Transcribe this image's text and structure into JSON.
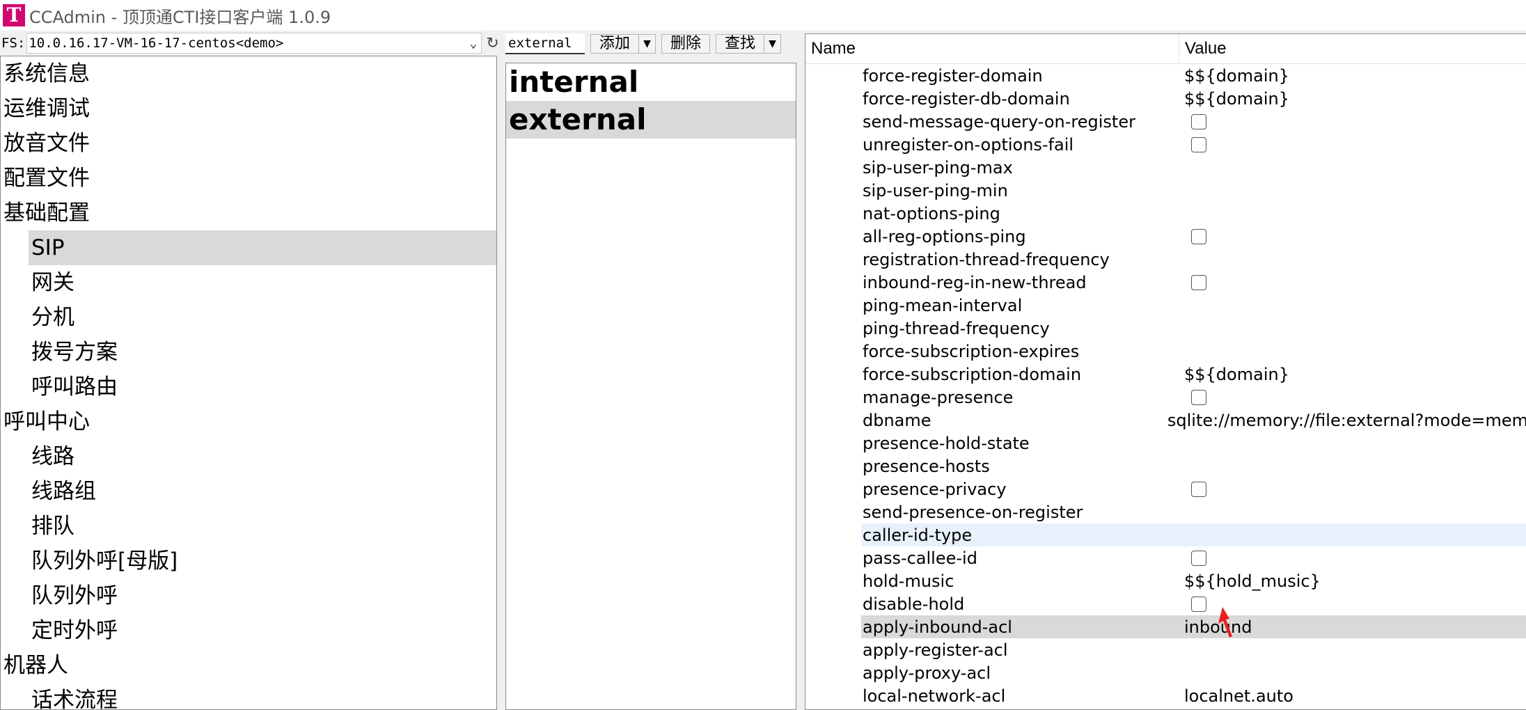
{
  "app": {
    "logo_letter": "T",
    "title": "CCAdmin - 顶顶通CTI接口客户端 1.0.9",
    "accent_color": "#d0076f"
  },
  "fs": {
    "label": "FS:",
    "server": "10.0.16.17-VM-16-17-centos<demo>"
  },
  "tree": {
    "items": [
      {
        "label": "系统信息",
        "level": 0
      },
      {
        "label": "运维调试",
        "level": 0
      },
      {
        "label": "放音文件",
        "level": 0
      },
      {
        "label": "配置文件",
        "level": 0
      },
      {
        "label": "基础配置",
        "level": 0
      },
      {
        "label": "SIP",
        "level": 1,
        "selected": true
      },
      {
        "label": "网关",
        "level": 1
      },
      {
        "label": "分机",
        "level": 1
      },
      {
        "label": "拨号方案",
        "level": 1
      },
      {
        "label": "呼叫路由",
        "level": 1
      },
      {
        "label": "呼叫中心",
        "level": 0
      },
      {
        "label": "线路",
        "level": 1
      },
      {
        "label": "线路组",
        "level": 1
      },
      {
        "label": "排队",
        "level": 1
      },
      {
        "label": "队列外呼[母版]",
        "level": 1
      },
      {
        "label": "队列外呼",
        "level": 1
      },
      {
        "label": "定时外呼",
        "level": 1
      },
      {
        "label": "机器人",
        "level": 0
      },
      {
        "label": "话术流程",
        "level": 1
      }
    ]
  },
  "toolbar": {
    "input_value": "external",
    "add_label": "添加",
    "delete_label": "删除",
    "find_label": "查找"
  },
  "profiles": {
    "items": [
      {
        "label": "internal",
        "selected": false
      },
      {
        "label": "external",
        "selected": true
      }
    ]
  },
  "grid": {
    "header_name": "Name",
    "header_value": "Value",
    "rows": [
      {
        "name": "force-register-domain",
        "value": "$${domain}",
        "type": "text"
      },
      {
        "name": "force-register-db-domain",
        "value": "$${domain}",
        "type": "text"
      },
      {
        "name": "send-message-query-on-register",
        "value": "",
        "type": "checkbox"
      },
      {
        "name": "unregister-on-options-fail",
        "value": "",
        "type": "checkbox"
      },
      {
        "name": "sip-user-ping-max",
        "value": "",
        "type": "text"
      },
      {
        "name": "sip-user-ping-min",
        "value": "",
        "type": "text"
      },
      {
        "name": "nat-options-ping",
        "value": "",
        "type": "text"
      },
      {
        "name": "all-reg-options-ping",
        "value": "",
        "type": "checkbox"
      },
      {
        "name": "registration-thread-frequency",
        "value": "",
        "type": "text"
      },
      {
        "name": "inbound-reg-in-new-thread",
        "value": "",
        "type": "checkbox"
      },
      {
        "name": "ping-mean-interval",
        "value": "",
        "type": "text"
      },
      {
        "name": "ping-thread-frequency",
        "value": "",
        "type": "text"
      },
      {
        "name": "force-subscription-expires",
        "value": "",
        "type": "text"
      },
      {
        "name": "force-subscription-domain",
        "value": "$${domain}",
        "type": "text"
      },
      {
        "name": "manage-presence",
        "value": "",
        "type": "checkbox"
      },
      {
        "name": "dbname",
        "value": "sqlite://memory://file:external?mode=mem",
        "type": "text"
      },
      {
        "name": "presence-hold-state",
        "value": "",
        "type": "text"
      },
      {
        "name": "presence-hosts",
        "value": "",
        "type": "text"
      },
      {
        "name": "presence-privacy",
        "value": "",
        "type": "checkbox"
      },
      {
        "name": "send-presence-on-register",
        "value": "",
        "type": "text"
      },
      {
        "name": "caller-id-type",
        "value": "",
        "type": "text",
        "state": "hover"
      },
      {
        "name": "pass-callee-id",
        "value": "",
        "type": "checkbox"
      },
      {
        "name": "hold-music",
        "value": "$${hold_music}",
        "type": "text"
      },
      {
        "name": "disable-hold",
        "value": "",
        "type": "checkbox"
      },
      {
        "name": "apply-inbound-acl",
        "value": "inbound",
        "type": "text",
        "state": "selected"
      },
      {
        "name": "apply-register-acl",
        "value": "",
        "type": "text"
      },
      {
        "name": "apply-proxy-acl",
        "value": "",
        "type": "text"
      },
      {
        "name": "local-network-acl",
        "value": "localnet.auto",
        "type": "text"
      }
    ]
  },
  "icons": {
    "fs_dropdown": "chevron-down-icon",
    "refresh": "refresh-icon",
    "annotation": "red-arrow-icon"
  }
}
